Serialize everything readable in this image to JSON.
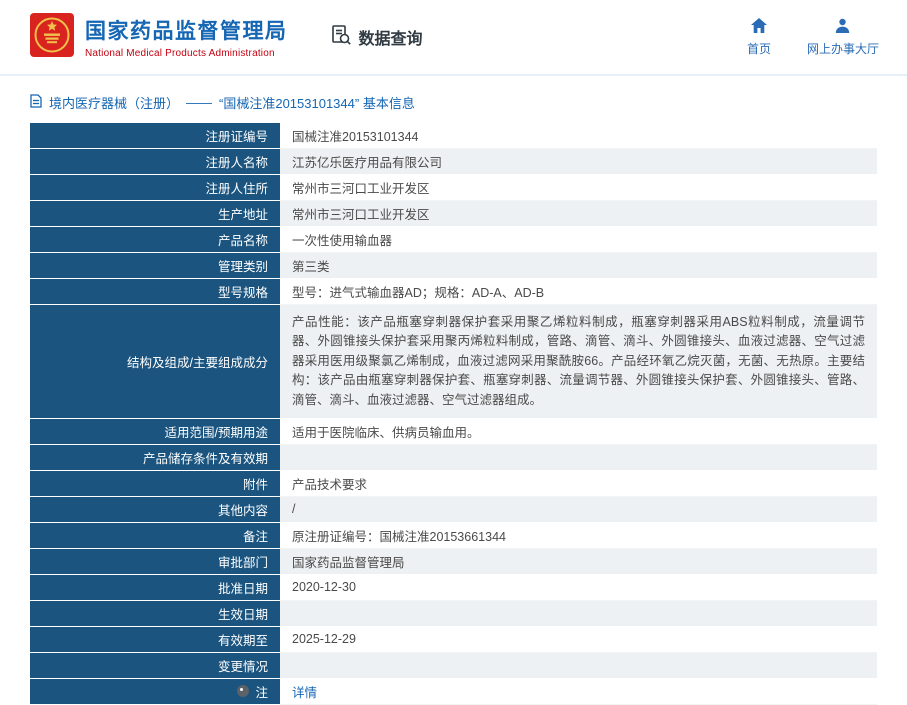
{
  "colors": {
    "accent_blue": "#1566b3",
    "label_bg": "#1a547f",
    "brand_red": "#c30010",
    "nav_blue": "#2a6cb5",
    "stripe": "#eef1f3"
  },
  "header": {
    "org_cn": "国家药品监督管理局",
    "org_en": "National Medical Products Administration",
    "data_query": "数据查询",
    "nav_home": "首页",
    "nav_hall": "网上办事大厅"
  },
  "breadcrumb": {
    "category": "境内医疗器械（注册）",
    "dash": "——",
    "title": "“国械注准20153101344” 基本信息"
  },
  "table": {
    "rows": [
      {
        "label": "注册证编号",
        "value": "国械注准20153101344"
      },
      {
        "label": "注册人名称",
        "value": "江苏亿乐医疗用品有限公司"
      },
      {
        "label": "注册人住所",
        "value": "常州市三河口工业开发区"
      },
      {
        "label": "生产地址",
        "value": "常州市三河口工业开发区"
      },
      {
        "label": "产品名称",
        "value": "一次性使用输血器"
      },
      {
        "label": "管理类别",
        "value": "第三类"
      },
      {
        "label": "型号规格",
        "value": "型号：进气式输血器AD；规格：AD-A、AD-B"
      },
      {
        "label": "结构及组成/主要组成成分",
        "value": "产品性能：该产品瓶塞穿刺器保护套采用聚乙烯粒料制成，瓶塞穿刺器采用ABS粒料制成，流量调节器、外圆锥接头保护套采用聚丙烯粒料制成，管路、滴管、滴斗、外圆锥接头、血液过滤器、空气过滤器采用医用级聚氯乙烯制成，血液过滤网采用聚酰胺66。产品经环氧乙烷灭菌，无菌、无热原。主要结构：该产品由瓶塞穿刺器保护套、瓶塞穿刺器、流量调节器、外圆锥接头保护套、外圆锥接头、管路、滴管、滴斗、血液过滤器、空气过滤器组成。"
      },
      {
        "label": "适用范围/预期用途",
        "value": "适用于医院临床、供病员输血用。"
      },
      {
        "label": "产品储存条件及有效期",
        "value": ""
      },
      {
        "label": "附件",
        "value": "产品技术要求"
      },
      {
        "label": "其他内容",
        "value": "/"
      },
      {
        "label": "备注",
        "value": "原注册证编号：国械注准20153661344"
      },
      {
        "label": "审批部门",
        "value": "国家药品监督管理局"
      },
      {
        "label": "批准日期",
        "value": "2020-12-30"
      },
      {
        "label": "生效日期",
        "value": ""
      },
      {
        "label": "有效期至",
        "value": "2025-12-29"
      },
      {
        "label": "变更情况",
        "value": ""
      },
      {
        "label": "注",
        "value": "详情"
      }
    ]
  }
}
